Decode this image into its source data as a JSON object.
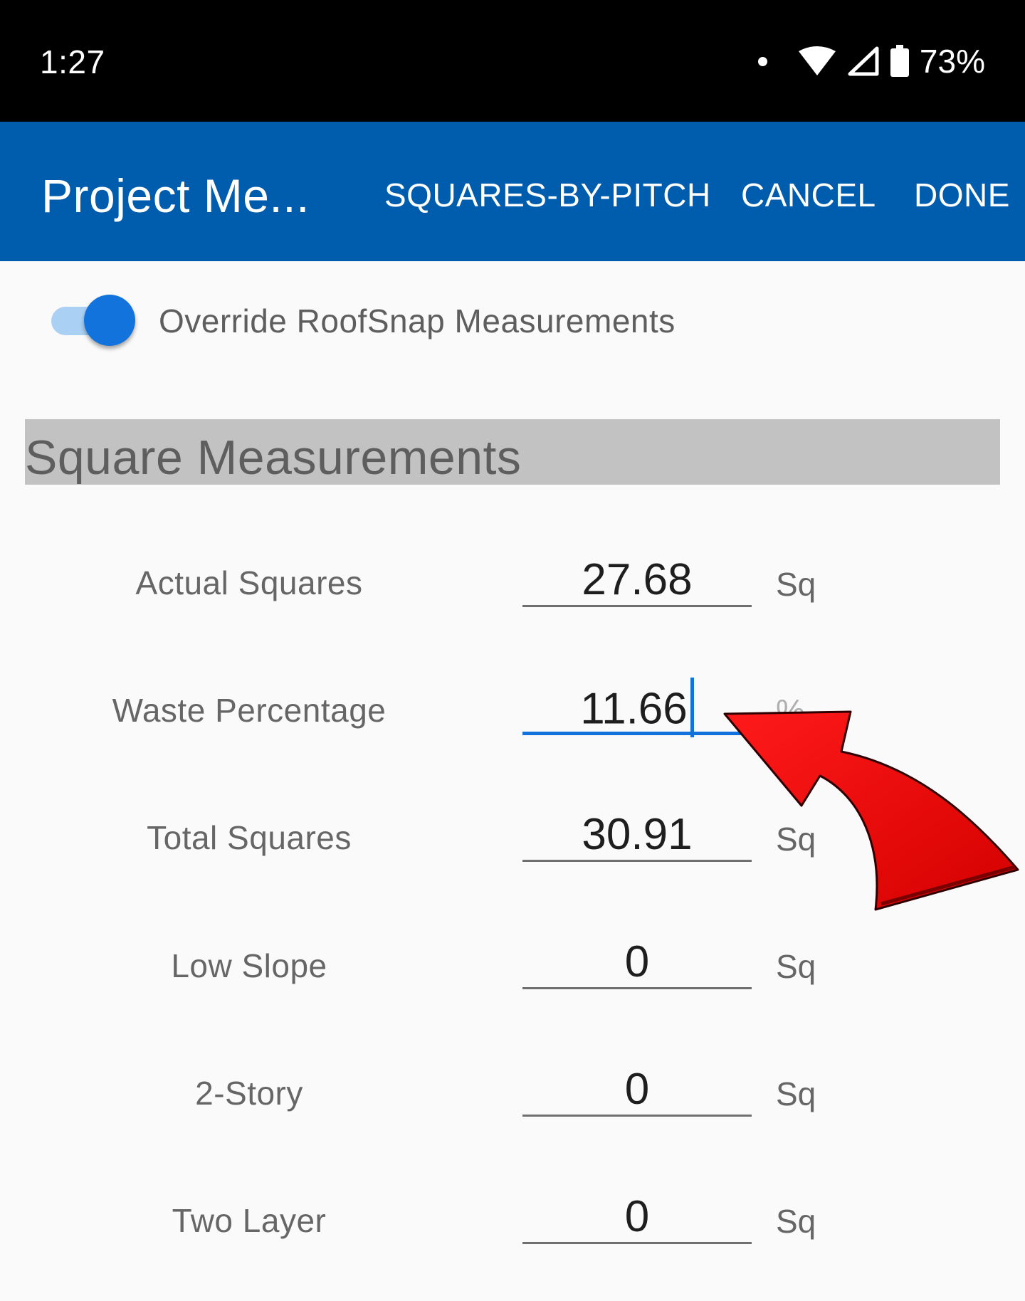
{
  "status_bar": {
    "time": "1:27",
    "battery": "73%"
  },
  "app_bar": {
    "title": "Project Me...",
    "actions": {
      "squares_by_pitch": "SQUARES-BY-PITCH",
      "cancel": "CANCEL",
      "done": "DONE"
    }
  },
  "override": {
    "label": "Override RoofSnap Measurements",
    "enabled": true
  },
  "section": {
    "title": "Square Measurements"
  },
  "rows": [
    {
      "label": "Actual Squares",
      "value": "27.68",
      "unit": "Sq"
    },
    {
      "label": "Waste Percentage",
      "value": "11.66",
      "unit": "%"
    },
    {
      "label": "Total Squares",
      "value": "30.91",
      "unit": "Sq"
    },
    {
      "label": "Low Slope",
      "value": "0",
      "unit": "Sq"
    },
    {
      "label": "2-Story",
      "value": "0",
      "unit": "Sq"
    },
    {
      "label": "Two Layer",
      "value": "0",
      "unit": "Sq"
    }
  ],
  "colors": {
    "app_bar": "#005cad",
    "accent": "#1273dd",
    "section_header_bg": "#c2c2c2",
    "annotation_arrow": "#ff0000"
  }
}
